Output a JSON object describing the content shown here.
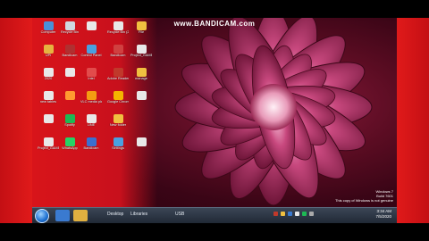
{
  "watermark": "www.BANDICAM.com",
  "desktop_icons": [
    {
      "label": "Computer",
      "color": "#4a90d9"
    },
    {
      "label": "Recycle Bin",
      "color": "#d0d8e0"
    },
    {
      "label": "",
      "color": "#e8e8e8"
    },
    {
      "label": "Recycle Bin (2)",
      "color": "#e8e8e8"
    },
    {
      "label": "File",
      "color": "#f0c040"
    },
    {
      "label": "UPI",
      "color": "#e6b340"
    },
    {
      "label": "Bandicam",
      "color": "#b03030"
    },
    {
      "label": "Control Panel",
      "color": "#4aa0e0"
    },
    {
      "label": "Bandicam",
      "color": "#d04040"
    },
    {
      "label": "Project_GAME",
      "color": "#e8e8e8"
    },
    {
      "label": "2020",
      "color": "#e8e8e8"
    },
    {
      "label": "",
      "color": "#e8e8e8"
    },
    {
      "label": "Intel",
      "color": "#e24b4b"
    },
    {
      "label": "Adobe Reader XI",
      "color": "#c0392b"
    },
    {
      "label": "manage",
      "color": "#f0c040"
    },
    {
      "label": "new tables",
      "color": "#e8e8e8"
    },
    {
      "label": "",
      "color": "#ff9b30"
    },
    {
      "label": "VLC media player",
      "color": "#f39c12"
    },
    {
      "label": "Google Chrome",
      "color": "#f4b400"
    },
    {
      "label": "",
      "color": "#e8e8e8"
    },
    {
      "label": "",
      "color": "#e8e8e8"
    },
    {
      "label": "Spotify",
      "color": "#1db954"
    },
    {
      "label": "LINE",
      "color": "#e8e8e8"
    },
    {
      "label": "New folder",
      "color": "#f0c040"
    },
    {
      "label": "Project_GAME (2)",
      "color": "#e8e8e8"
    },
    {
      "label": "WhatsApp",
      "color": "#25d366"
    },
    {
      "label": "Bandicam",
      "color": "#3a6fd0"
    },
    {
      "label": "Settings",
      "color": "#4aa0e0"
    },
    {
      "label": "",
      "color": "#e8e8e8"
    }
  ],
  "taskbar": {
    "desktop_label": "Desktop",
    "libraries_label": "Libraries",
    "usb_label": "USB"
  },
  "clock": {
    "time": "3:34 AM",
    "date": "7/5/2020"
  },
  "windows_notice": {
    "line1": "Windows 7",
    "line2": "Build 7601",
    "line3": "This copy of Windows is not genuine"
  },
  "colors": {
    "accent": "#d8141a",
    "taskbar": "#2a3240"
  }
}
